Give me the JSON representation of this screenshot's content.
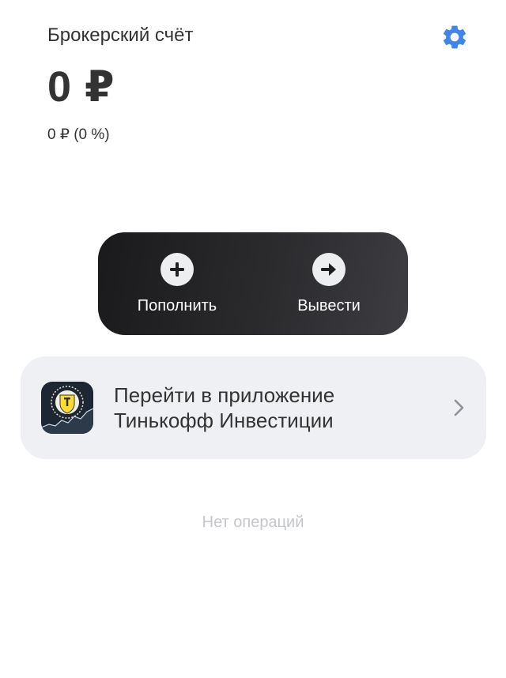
{
  "header": {
    "title": "Брокерский счёт",
    "settings_icon": "gear-icon",
    "accent_color": "#3f86e8"
  },
  "balance": {
    "amount": "0 ₽",
    "change": "0 ₽ (0 %)"
  },
  "actions": {
    "deposit_label": "Пополнить",
    "deposit_icon": "plus-icon",
    "withdraw_label": "Вывести",
    "withdraw_icon": "arrow-right-icon"
  },
  "app_link": {
    "line1": "Перейти в приложение",
    "line2": "Тинькофф Инвестиции",
    "icon": "tinkoff-investments-app-icon",
    "chevron_icon": "chevron-right-icon"
  },
  "operations": {
    "empty_text": "Нет операций"
  }
}
